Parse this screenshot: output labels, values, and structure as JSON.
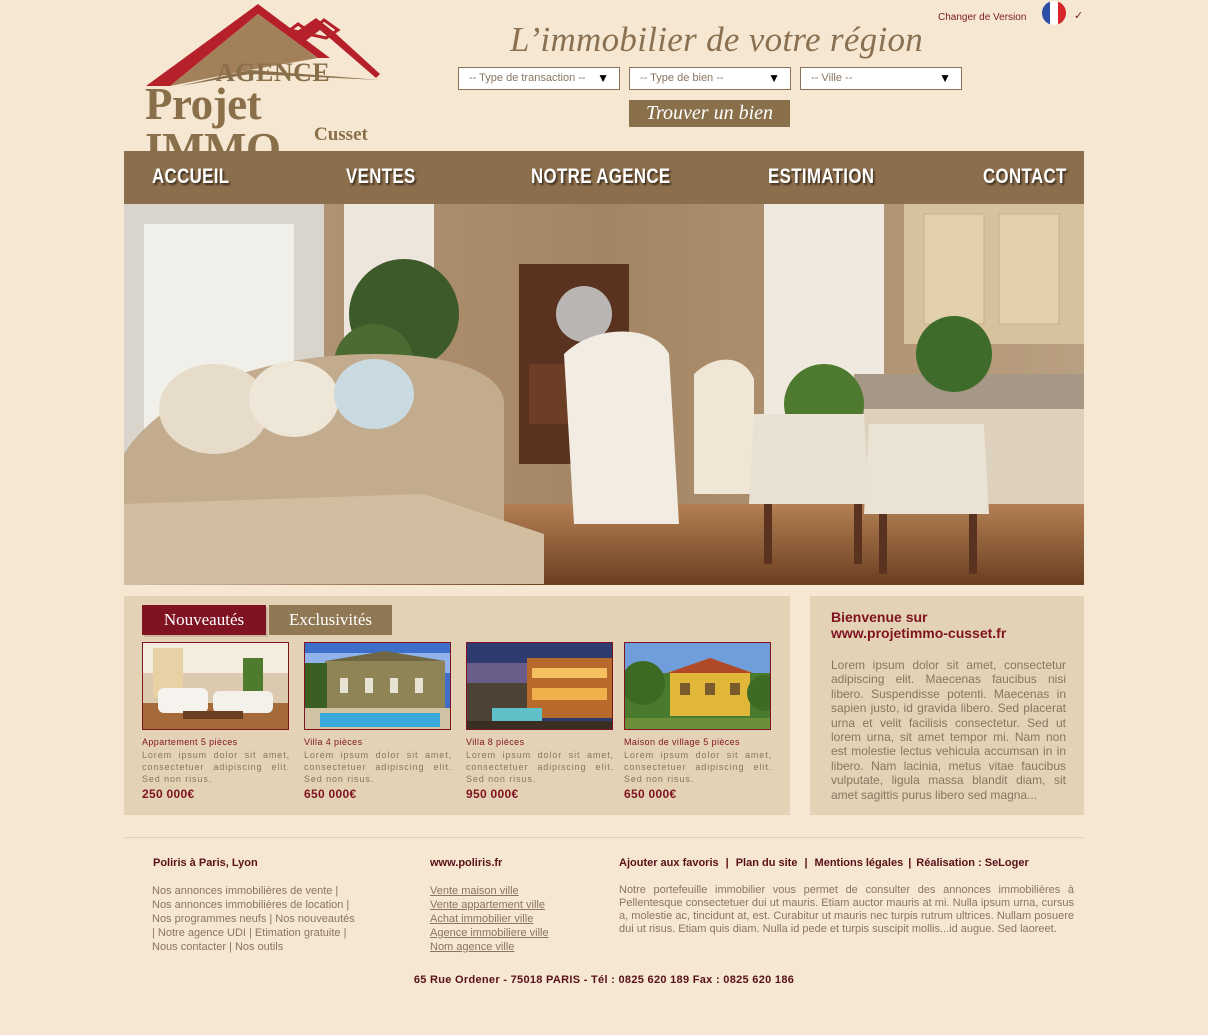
{
  "header": {
    "logo_top": "AGENCE",
    "logo_main": "Projet IMMO",
    "logo_city": "Cusset",
    "version_label": "Changer de Version",
    "tagline": "L’immobilier de votre région"
  },
  "search": {
    "transaction": "-- Type de transaction --",
    "property": "-- Type de bien --",
    "city": "-- Ville --",
    "button": "Trouver un bien"
  },
  "nav": {
    "items": [
      "ACCUEIL",
      "VENTES",
      "NOTRE AGENCE",
      "ESTIMATION",
      "CONTACT"
    ]
  },
  "listings": {
    "tabs": [
      "Nouveautés",
      "Exclusivités"
    ],
    "items": [
      {
        "title": "Appartement 5 pièces",
        "desc": "Lorem ipsum dolor sit amet, consectetuer adipiscing elit. Sed non risus.",
        "price": "250 000€"
      },
      {
        "title": "Villa 4 pièces",
        "desc": "Lorem ipsum dolor sit amet, consectetuer adipiscing elit. Sed non risus.",
        "price": "650 000€"
      },
      {
        "title": "Villa 8 pièces",
        "desc": "Lorem ipsum dolor sit amet, consectetuer adipiscing elit. Sed non risus.",
        "price": "950 000€"
      },
      {
        "title": "Maison de village 5 pièces",
        "desc": "Lorem ipsum dolor sit amet, consectetuer adipiscing elit. Sed non risus.",
        "price": "650 000€"
      }
    ]
  },
  "welcome": {
    "title_line1": "Bienvenue sur",
    "title_line2": "www.projetimmo-cusset.fr",
    "text": "Lorem ipsum dolor sit amet, consectetur adipiscing elit. Maecenas faucibus nisi libero. Suspendisse potenti. Maecenas in sapien justo, id gravida libero. Sed placerat urna et velit facilisis consectetur. Sed ut lorem urna, sit amet tempor mi. Nam non est molestie lectus vehicula accumsan in in libero. Nam lacinia, metus vitae faucibus vulputate, ligula massa blandit diam, sit amet sagittis purus libero sed magna..."
  },
  "footer": {
    "col1_title": "Poliris à Paris, Lyon",
    "col1_lines": [
      "Nos annonces immobilières de vente |",
      "Nos annonces immobilières de location |",
      "Nos programmes neufs | Nos nouveautés",
      "| Notre agence UDI | Etimation gratuite |",
      "Nous contacter | Nos outils"
    ],
    "col2_title": "www.poliris.fr",
    "col2_links": [
      "Vente maison ville",
      "Vente appartement ville",
      "Achat immobilier ville",
      "Agence immobiliere ville",
      "Nom agence ville"
    ],
    "links": [
      "Ajouter aux favoris",
      "Plan du site",
      "Mentions légales",
      "Réalisation : SeLoger"
    ],
    "link_sep": "|",
    "text": "Notre portefeuille immobilier vous permet de consulter des annonces immobilières à Pellentesque consectetuer dui ut mauris. Etiam auctor mauris at mi. Nulla ipsum urna, cursus a, molestie ac, tincidunt at, est. Curabitur ut mauris nec turpis rutrum ultrices. Nullam posuere dui ut risus. Etiam quis diam. Nulla id pede et turpis suscipit mollis...id augue. Sed laoreet.",
    "address": "65 Rue Ordener - 75018 PARIS  -  Tél : 0825 620 189  Fax : 0825 620 186"
  },
  "colors": {
    "background": "#f5e7d1",
    "nav": "#8b6e4c",
    "accent": "#7f1322",
    "panel": "#e3d2b6",
    "text": "#8a7560"
  },
  "icons": [
    "house-roof-logo",
    "france-flag-icon",
    "chevron-down-icon",
    "dropdown-arrow-icon"
  ]
}
